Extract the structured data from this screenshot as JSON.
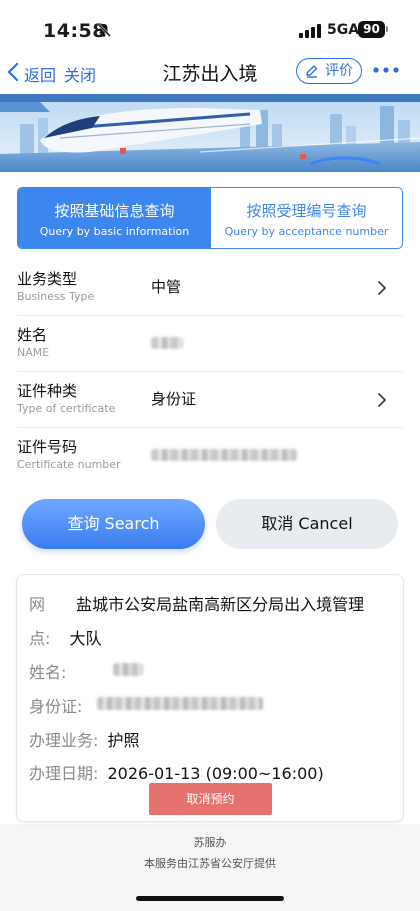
{
  "status_bar": {
    "time": "14:58",
    "network": "5GA",
    "battery": "90"
  },
  "nav": {
    "back_label": "返回",
    "close_label": "关闭",
    "title": "江苏出入境",
    "rate_label": "评价"
  },
  "tabs": [
    {
      "label": "按照基础信息查询",
      "sublabel": "Query by basic information",
      "active": true
    },
    {
      "label": "按照受理编号查询",
      "sublabel": "Query by acceptance number",
      "active": false
    }
  ],
  "form": {
    "business_type": {
      "label": "业务类型",
      "sublabel": "Business Type",
      "value": "中管"
    },
    "name": {
      "label": "姓名",
      "sublabel": "NAME"
    },
    "cert_type": {
      "label": "证件种类",
      "sublabel": "Type of certificate",
      "value": "身份证"
    },
    "cert_no": {
      "label": "证件号码",
      "sublabel": "Certificate number"
    }
  },
  "buttons": {
    "search": "查询 Search",
    "cancel": "取消 Cancel"
  },
  "result": {
    "office_label_1": "网",
    "office_label_2": "点:",
    "office_value_1": "盐城市公安局盐南高新区分局出入境管理",
    "office_value_2": "大队",
    "name_label": "姓名:",
    "id_label": "身份证:",
    "business_label": "办理业务:",
    "business_value": "护照",
    "date_label": "办理日期:",
    "date_value": "2026-01-13 (09:00~16:00)",
    "cancel_label": "取消预约"
  },
  "footer": {
    "line1": "苏服办",
    "line2": "本服务由江苏省公安厅提供"
  },
  "colors": {
    "accent": "#3d86f0",
    "link": "#2a6fe8",
    "cancel_red": "#e5726e"
  }
}
